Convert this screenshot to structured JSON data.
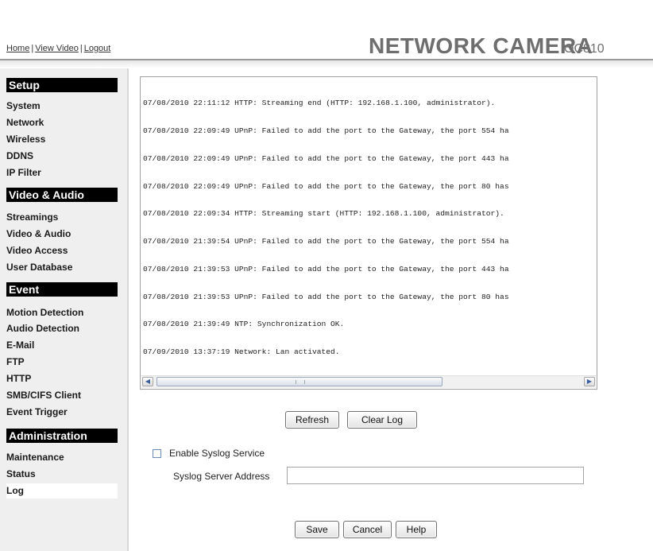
{
  "header": {
    "nav": {
      "home": "Home",
      "view_video": "View Video",
      "logout": "Logout",
      "separator": "|"
    },
    "brand": "NETWORK CAMERA",
    "model": "OC810"
  },
  "sidebar": {
    "sections": [
      {
        "title": "Setup",
        "items": [
          "System",
          "Network",
          "Wireless",
          "DDNS",
          "IP Filter"
        ]
      },
      {
        "title": "Video & Audio",
        "items": [
          "Streamings",
          "Video & Audio",
          "Video Access",
          "User Database"
        ]
      },
      {
        "title": "Event",
        "items": [
          "Motion Detection",
          "Audio Detection",
          "E-Mail",
          "FTP",
          "HTTP",
          "SMB/CIFS Client",
          "Event Trigger"
        ]
      },
      {
        "title": "Administration",
        "items": [
          "Maintenance",
          "Status",
          "Log"
        ]
      }
    ],
    "active_item": "Log"
  },
  "log": {
    "lines": [
      "07/08/2010 22:11:12 HTTP: Streaming end (HTTP: 192.168.1.100, administrator).",
      "07/08/2010 22:09:49 UPnP: Failed to add the port to the Gateway, the port 554 ha",
      "07/08/2010 22:09:49 UPnP: Failed to add the port to the Gateway, the port 443 ha",
      "07/08/2010 22:09:49 UPnP: Failed to add the port to the Gateway, the port 80 has",
      "07/08/2010 22:09:34 HTTP: Streaming start (HTTP: 192.168.1.100, administrator).",
      "07/08/2010 21:39:54 UPnP: Failed to add the port to the Gateway, the port 554 ha",
      "07/08/2010 21:39:53 UPnP: Failed to add the port to the Gateway, the port 443 ha",
      "07/08/2010 21:39:53 UPnP: Failed to add the port to the Gateway, the port 80 has",
      "07/08/2010 21:39:49 NTP: Synchronization OK.",
      "07/09/2010 13:37:19 Network: Lan activated."
    ]
  },
  "actions": {
    "refresh": "Refresh",
    "clear_log": "Clear Log"
  },
  "syslog": {
    "enable_label": "Enable Syslog Service",
    "enabled": false,
    "server_label": "Syslog Server Address",
    "server_value": ""
  },
  "footer": {
    "save": "Save",
    "cancel": "Cancel",
    "help": "Help"
  },
  "icons": {
    "scroll_left": "scroll-left-arrow-icon",
    "scroll_right": "scroll-right-arrow-icon"
  }
}
